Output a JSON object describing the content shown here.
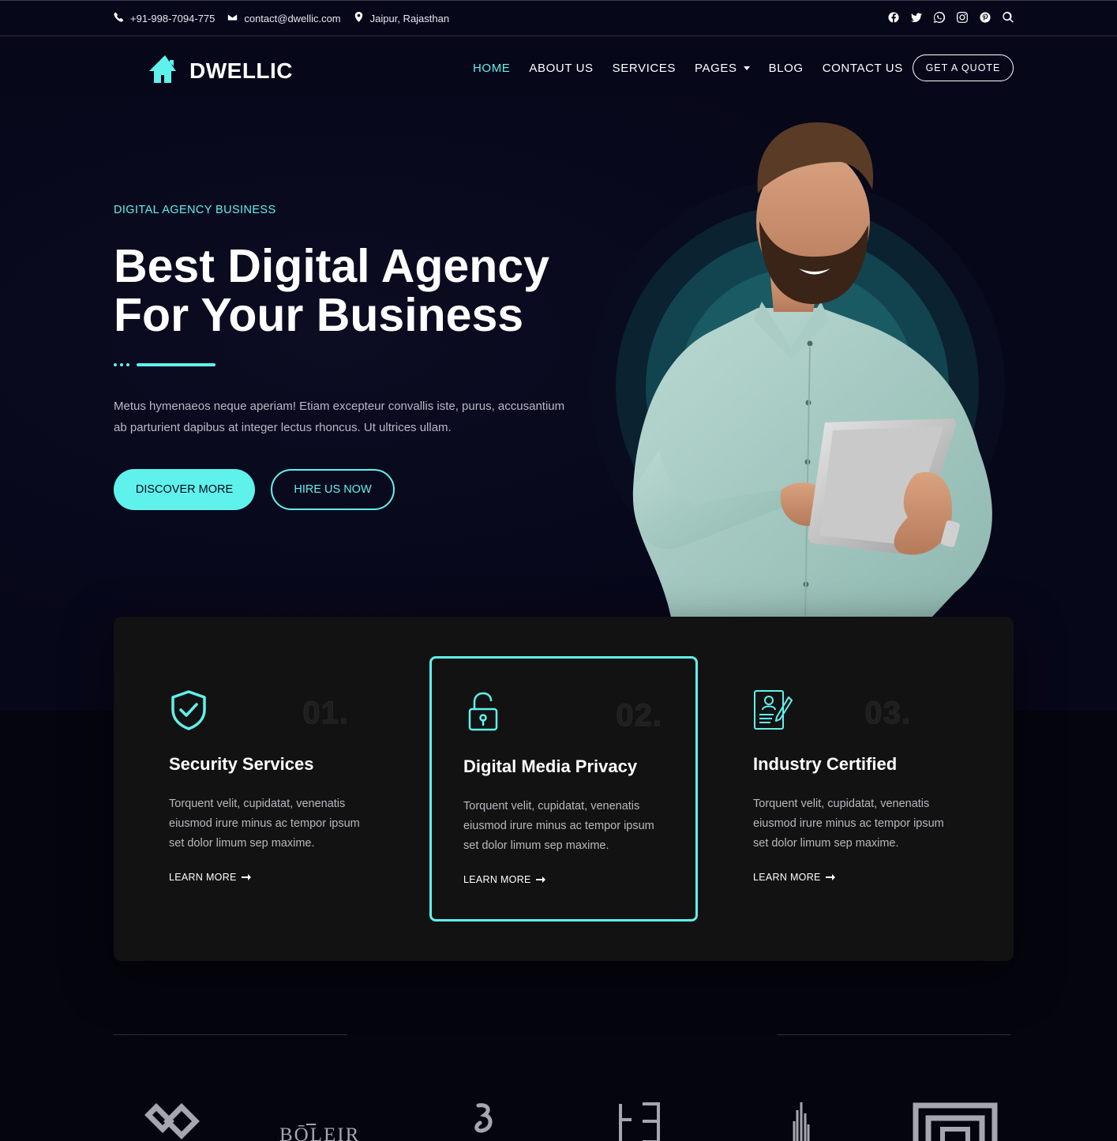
{
  "topbar": {
    "phone": "+91-998-7094-775",
    "email": "contact@dwellic.com",
    "location": "Jaipur, Rajasthan",
    "social_icons": [
      "facebook-icon",
      "twitter-icon",
      "whatsapp-icon",
      "instagram-icon",
      "pinterest-icon",
      "search-icon"
    ]
  },
  "header": {
    "logo_text": "DWELLIC",
    "nav": [
      {
        "label": "HOME",
        "active": true
      },
      {
        "label": "ABOUT US"
      },
      {
        "label": "SERVICES"
      },
      {
        "label": "PAGES",
        "dropdown": true
      },
      {
        "label": "BLOG"
      },
      {
        "label": "CONTACT US"
      }
    ],
    "cta_label": "GET A QUOTE"
  },
  "hero": {
    "eyebrow": "DIGITAL AGENCY BUSINESS",
    "title_line1": "Best Digital Agency",
    "title_line2": "For Your Business",
    "text": "Metus hymenaeos neque aperiam! Etiam excepteur convallis iste, purus, accusantium ab parturient dapibus at integer lectus rhoncus. Ut ultrices ullam.",
    "primary_button": "DISCOVER MORE",
    "secondary_button": "HIRE US NOW"
  },
  "features": [
    {
      "number": "01.",
      "title": "Security Services",
      "desc": "Torquent velit, cupidatat, venenatis eiusmod irure minus ac tempor ipsum set dolor limum sep maxime.",
      "link": "LEARN MORE",
      "icon": "shield-check-icon"
    },
    {
      "number": "02.",
      "title": "Digital Media Privacy",
      "desc": "Torquent velit, cupidatat, venenatis eiusmod irure minus ac tempor ipsum set dolor limum sep maxime.",
      "link": "LEARN MORE",
      "icon": "unlock-icon",
      "highlighted": true
    },
    {
      "number": "03.",
      "title": "Industry Certified",
      "desc": "Torquent velit, cupidatat, venenatis eiusmod irure minus ac tempor ipsum set dolor limum sep maxime.",
      "link": "LEARN MORE",
      "icon": "certificate-icon"
    }
  ],
  "partners": {
    "logos": [
      "diamond-logo",
      "boleir-logo",
      "b-monogram-logo",
      "bracket-logo",
      "tower-logo",
      "square-logo"
    ],
    "boleir_text": "BŌLEIR"
  },
  "colors": {
    "accent": "#5ff2ec",
    "background": "#07071a",
    "panel": "#121212"
  }
}
